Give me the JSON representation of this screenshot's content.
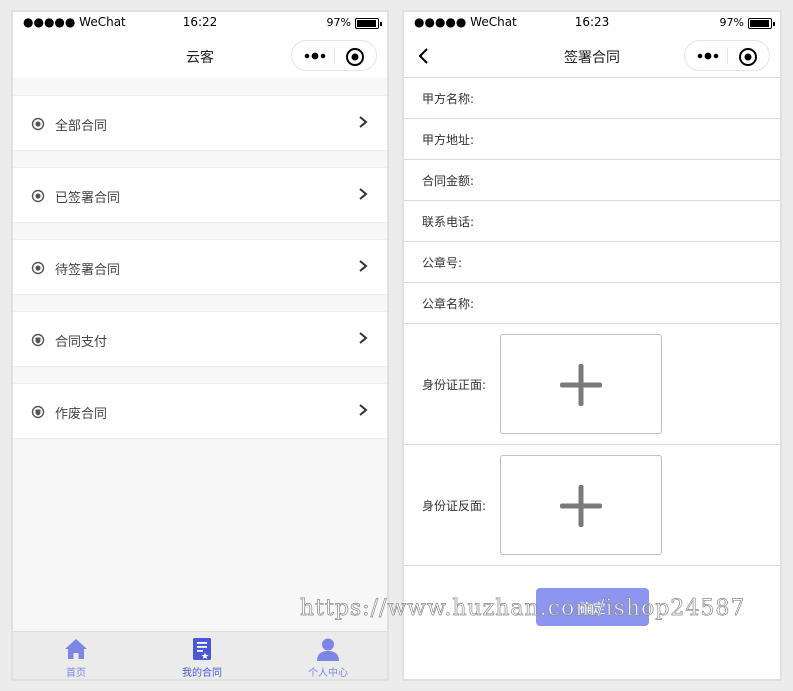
{
  "left_screen": {
    "status": {
      "carrier": "●●●●● WeChat",
      "time": "16:22",
      "battery": "97%"
    },
    "battery_level": 0.97,
    "nav_title": "云客",
    "menu_items": [
      {
        "label": "全部合同",
        "icon": "radio-dot-icon"
      },
      {
        "label": "已签署合同",
        "icon": "radio-dot-icon"
      },
      {
        "label": "待签署合同",
        "icon": "radio-dot-icon"
      },
      {
        "label": "合同支付",
        "icon": "shield-icon"
      },
      {
        "label": "作废合同",
        "icon": "shield-icon"
      }
    ],
    "tabs": [
      {
        "label": "首页",
        "icon": "home-icon"
      },
      {
        "label": "我的合同",
        "icon": "contract-icon"
      },
      {
        "label": "个人中心",
        "icon": "user-icon"
      }
    ],
    "active_tab": 1
  },
  "right_screen": {
    "status": {
      "carrier": "●●●●● WeChat",
      "time": "16:23",
      "battery": "97%"
    },
    "battery_level": 0.97,
    "nav_title": "签署合同",
    "fields": [
      {
        "label": "甲方名称:",
        "value": ""
      },
      {
        "label": "甲方地址:",
        "value": ""
      },
      {
        "label": "合同金额:",
        "value": ""
      },
      {
        "label": "联系电话:",
        "value": ""
      },
      {
        "label": "公章号:",
        "value": ""
      },
      {
        "label": "公章名称:",
        "value": ""
      }
    ],
    "uploads": [
      {
        "label": "身份证正面:",
        "icon": "plus-icon"
      },
      {
        "label": "身份证反面:",
        "icon": "plus-icon"
      }
    ],
    "confirm_label": "确定"
  },
  "watermark": "https://www.huzhan.com/ishop24587",
  "colors": {
    "accent": "#8c95ef",
    "tab_active": "#4a57d6",
    "tab_inactive": "#7d86e6"
  }
}
